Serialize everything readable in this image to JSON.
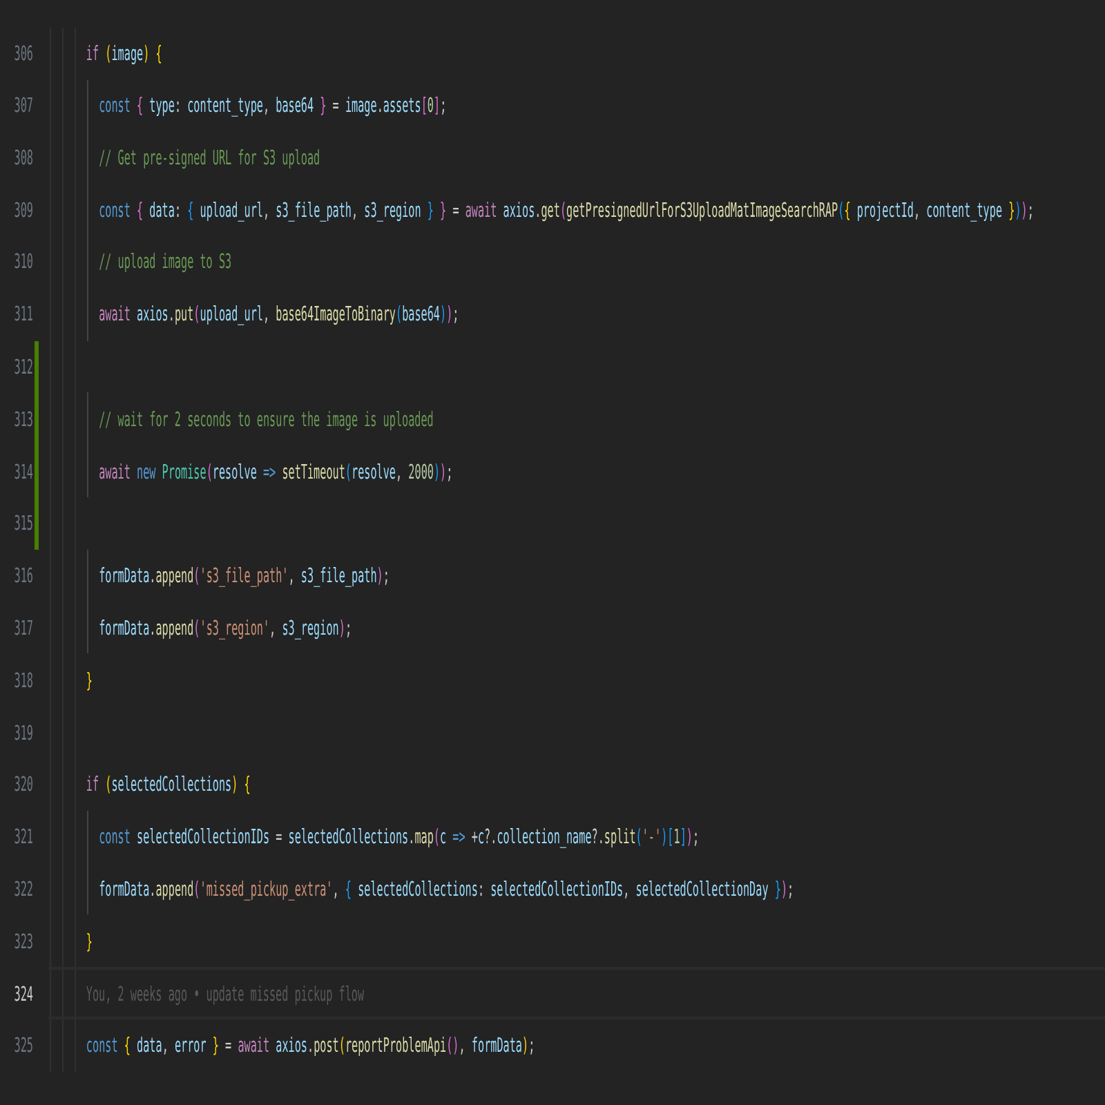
{
  "editor": {
    "lines": [
      {
        "number": "306",
        "added": false,
        "current": false,
        "tokens": [
          {
            "kind": "kw",
            "text": "      if"
          },
          {
            "kind": "b1",
            "text": " ("
          },
          {
            "kind": "v",
            "text": "image"
          },
          {
            "kind": "b1",
            "text": ")"
          },
          {
            "kind": "b1",
            "text": " {"
          }
        ]
      },
      {
        "number": "307",
        "added": false,
        "current": false,
        "tokens": [
          {
            "kind": "st",
            "text": "        const"
          },
          {
            "kind": "b2",
            "text": " {"
          },
          {
            "kind": "v",
            "text": " type"
          },
          {
            "kind": "p",
            "text": ": "
          },
          {
            "kind": "v",
            "text": "content_type"
          },
          {
            "kind": "p",
            "text": ", "
          },
          {
            "kind": "v",
            "text": "base64"
          },
          {
            "kind": "b2",
            "text": " }"
          },
          {
            "kind": "p",
            "text": " = "
          },
          {
            "kind": "v",
            "text": "image"
          },
          {
            "kind": "p",
            "text": "."
          },
          {
            "kind": "v",
            "text": "assets"
          },
          {
            "kind": "b2",
            "text": "["
          },
          {
            "kind": "n",
            "text": "0"
          },
          {
            "kind": "b2",
            "text": "]"
          },
          {
            "kind": "p",
            "text": ";"
          }
        ]
      },
      {
        "number": "308",
        "added": false,
        "current": false,
        "tokens": [
          {
            "kind": "c",
            "text": "        // Get pre-signed URL for S3 upload"
          }
        ]
      },
      {
        "number": "309",
        "added": false,
        "current": false,
        "tokens": [
          {
            "kind": "st",
            "text": "        const"
          },
          {
            "kind": "b2",
            "text": " {"
          },
          {
            "kind": "v",
            "text": " data"
          },
          {
            "kind": "p",
            "text": ": "
          },
          {
            "kind": "b3",
            "text": "{"
          },
          {
            "kind": "v",
            "text": " upload_url"
          },
          {
            "kind": "p",
            "text": ", "
          },
          {
            "kind": "v",
            "text": "s3_file_path"
          },
          {
            "kind": "p",
            "text": ", "
          },
          {
            "kind": "v",
            "text": "s3_region"
          },
          {
            "kind": "b3",
            "text": " }"
          },
          {
            "kind": "b2",
            "text": " }"
          },
          {
            "kind": "p",
            "text": " = "
          },
          {
            "kind": "kw",
            "text": "await"
          },
          {
            "kind": "v",
            "text": " axios"
          },
          {
            "kind": "p",
            "text": "."
          },
          {
            "kind": "f",
            "text": "get"
          },
          {
            "kind": "b2",
            "text": "("
          },
          {
            "kind": "f",
            "text": "getPresignedUrlForS3UploadMatImageSearchRAP"
          },
          {
            "kind": "b3",
            "text": "("
          },
          {
            "kind": "b1",
            "text": "{"
          },
          {
            "kind": "v",
            "text": " projectId"
          },
          {
            "kind": "p",
            "text": ", "
          },
          {
            "kind": "v",
            "text": "content_type"
          },
          {
            "kind": "b1",
            "text": " }"
          },
          {
            "kind": "b3",
            "text": ")"
          },
          {
            "kind": "b2",
            "text": ")"
          },
          {
            "kind": "p",
            "text": ";"
          }
        ]
      },
      {
        "number": "310",
        "added": false,
        "current": false,
        "tokens": [
          {
            "kind": "c",
            "text": "        // upload image to S3"
          }
        ]
      },
      {
        "number": "311",
        "added": false,
        "current": false,
        "tokens": [
          {
            "kind": "kw",
            "text": "        await"
          },
          {
            "kind": "v",
            "text": " axios"
          },
          {
            "kind": "p",
            "text": "."
          },
          {
            "kind": "f",
            "text": "put"
          },
          {
            "kind": "b2",
            "text": "("
          },
          {
            "kind": "v",
            "text": "upload_url"
          },
          {
            "kind": "p",
            "text": ", "
          },
          {
            "kind": "f",
            "text": "base64ImageToBinary"
          },
          {
            "kind": "b3",
            "text": "("
          },
          {
            "kind": "v",
            "text": "base64"
          },
          {
            "kind": "b3",
            "text": ")"
          },
          {
            "kind": "b2",
            "text": ")"
          },
          {
            "kind": "p",
            "text": ";"
          }
        ]
      },
      {
        "number": "312",
        "added": true,
        "current": false
      },
      {
        "number": "313",
        "added": true,
        "current": false,
        "tokens": [
          {
            "kind": "c",
            "text": "        // wait for 2 seconds to ensure the image is uploaded"
          }
        ]
      },
      {
        "number": "314",
        "added": true,
        "current": false,
        "tokens": [
          {
            "kind": "kw",
            "text": "        await"
          },
          {
            "kind": "st",
            "text": " new"
          },
          {
            "kind": "ty",
            "text": " Promise"
          },
          {
            "kind": "b2",
            "text": "("
          },
          {
            "kind": "v",
            "text": "resolve"
          },
          {
            "kind": "st",
            "text": " =>"
          },
          {
            "kind": "f",
            "text": " setTimeout"
          },
          {
            "kind": "b3",
            "text": "("
          },
          {
            "kind": "v",
            "text": "resolve"
          },
          {
            "kind": "p",
            "text": ", "
          },
          {
            "kind": "n",
            "text": "2000"
          },
          {
            "kind": "b3",
            "text": ")"
          },
          {
            "kind": "b2",
            "text": ")"
          },
          {
            "kind": "p",
            "text": ";"
          }
        ]
      },
      {
        "number": "315",
        "added": true,
        "current": false
      },
      {
        "number": "316",
        "added": false,
        "current": false,
        "tokens": [
          {
            "kind": "v",
            "text": "        formData"
          },
          {
            "kind": "p",
            "text": "."
          },
          {
            "kind": "f",
            "text": "append"
          },
          {
            "kind": "b2",
            "text": "("
          },
          {
            "kind": "s",
            "text": "'s3_file_path'"
          },
          {
            "kind": "p",
            "text": ", "
          },
          {
            "kind": "v",
            "text": "s3_file_path"
          },
          {
            "kind": "b2",
            "text": ")"
          },
          {
            "kind": "p",
            "text": ";"
          }
        ]
      },
      {
        "number": "317",
        "added": false,
        "current": false,
        "tokens": [
          {
            "kind": "v",
            "text": "        formData"
          },
          {
            "kind": "p",
            "text": "."
          },
          {
            "kind": "f",
            "text": "append"
          },
          {
            "kind": "b2",
            "text": "("
          },
          {
            "kind": "s",
            "text": "'s3_region'"
          },
          {
            "kind": "p",
            "text": ", "
          },
          {
            "kind": "v",
            "text": "s3_region"
          },
          {
            "kind": "b2",
            "text": ")"
          },
          {
            "kind": "p",
            "text": ";"
          }
        ]
      },
      {
        "number": "318",
        "added": false,
        "current": false,
        "tokens": [
          {
            "kind": "b1",
            "text": "      }"
          }
        ]
      },
      {
        "number": "319",
        "added": false,
        "current": false
      },
      {
        "number": "320",
        "added": false,
        "current": false,
        "tokens": [
          {
            "kind": "kw",
            "text": "      if"
          },
          {
            "kind": "b1",
            "text": " ("
          },
          {
            "kind": "v",
            "text": "selectedCollections"
          },
          {
            "kind": "b1",
            "text": ")"
          },
          {
            "kind": "b1",
            "text": " {"
          }
        ]
      },
      {
        "number": "321",
        "added": false,
        "current": false,
        "tokens": [
          {
            "kind": "st",
            "text": "        const"
          },
          {
            "kind": "v",
            "text": " selectedCollectionIDs"
          },
          {
            "kind": "p",
            "text": " = "
          },
          {
            "kind": "v",
            "text": "selectedCollections"
          },
          {
            "kind": "p",
            "text": "."
          },
          {
            "kind": "f",
            "text": "map"
          },
          {
            "kind": "b2",
            "text": "("
          },
          {
            "kind": "v",
            "text": "c"
          },
          {
            "kind": "st",
            "text": " =>"
          },
          {
            "kind": "p",
            "text": " +"
          },
          {
            "kind": "v",
            "text": "c"
          },
          {
            "kind": "p",
            "text": "?."
          },
          {
            "kind": "v",
            "text": "collection_name"
          },
          {
            "kind": "p",
            "text": "?."
          },
          {
            "kind": "f",
            "text": "split"
          },
          {
            "kind": "b3",
            "text": "("
          },
          {
            "kind": "s",
            "text": "'-'"
          },
          {
            "kind": "b3",
            "text": ")"
          },
          {
            "kind": "b3",
            "text": "["
          },
          {
            "kind": "n",
            "text": "1"
          },
          {
            "kind": "b3",
            "text": "]"
          },
          {
            "kind": "b2",
            "text": ")"
          },
          {
            "kind": "p",
            "text": ";"
          }
        ]
      },
      {
        "number": "322",
        "added": false,
        "current": false,
        "tokens": [
          {
            "kind": "v",
            "text": "        formData"
          },
          {
            "kind": "p",
            "text": "."
          },
          {
            "kind": "f",
            "text": "append"
          },
          {
            "kind": "b2",
            "text": "("
          },
          {
            "kind": "s",
            "text": "'missed_pickup_extra'"
          },
          {
            "kind": "p",
            "text": ", "
          },
          {
            "kind": "b3",
            "text": "{"
          },
          {
            "kind": "v",
            "text": " selectedCollections"
          },
          {
            "kind": "p",
            "text": ": "
          },
          {
            "kind": "v",
            "text": "selectedCollectionIDs"
          },
          {
            "kind": "p",
            "text": ", "
          },
          {
            "kind": "v",
            "text": "selectedCollectionDay"
          },
          {
            "kind": "b3",
            "text": " }"
          },
          {
            "kind": "b2",
            "text": ")"
          },
          {
            "kind": "p",
            "text": ";"
          }
        ]
      },
      {
        "number": "323",
        "added": false,
        "current": false,
        "tokens": [
          {
            "kind": "b1",
            "text": "      }"
          }
        ]
      },
      {
        "number": "324",
        "added": false,
        "current": true,
        "blame": "You, 2 weeks ago • update missed pickup flow"
      },
      {
        "number": "325",
        "added": false,
        "current": false,
        "tokens": [
          {
            "kind": "st",
            "text": "      const"
          },
          {
            "kind": "b1",
            "text": " {"
          },
          {
            "kind": "v",
            "text": " data"
          },
          {
            "kind": "p",
            "text": ", "
          },
          {
            "kind": "v",
            "text": "error"
          },
          {
            "kind": "b1",
            "text": " }"
          },
          {
            "kind": "p",
            "text": " = "
          },
          {
            "kind": "kw",
            "text": "await"
          },
          {
            "kind": "v",
            "text": " axios"
          },
          {
            "kind": "p",
            "text": "."
          },
          {
            "kind": "f",
            "text": "post"
          },
          {
            "kind": "b1",
            "text": "("
          },
          {
            "kind": "f",
            "text": "reportProblemApi"
          },
          {
            "kind": "b2",
            "text": "()"
          },
          {
            "kind": "p",
            "text": ", "
          },
          {
            "kind": "v",
            "text": "formData"
          },
          {
            "kind": "b1",
            "text": ")"
          },
          {
            "kind": "p",
            "text": ";"
          }
        ]
      }
    ]
  }
}
